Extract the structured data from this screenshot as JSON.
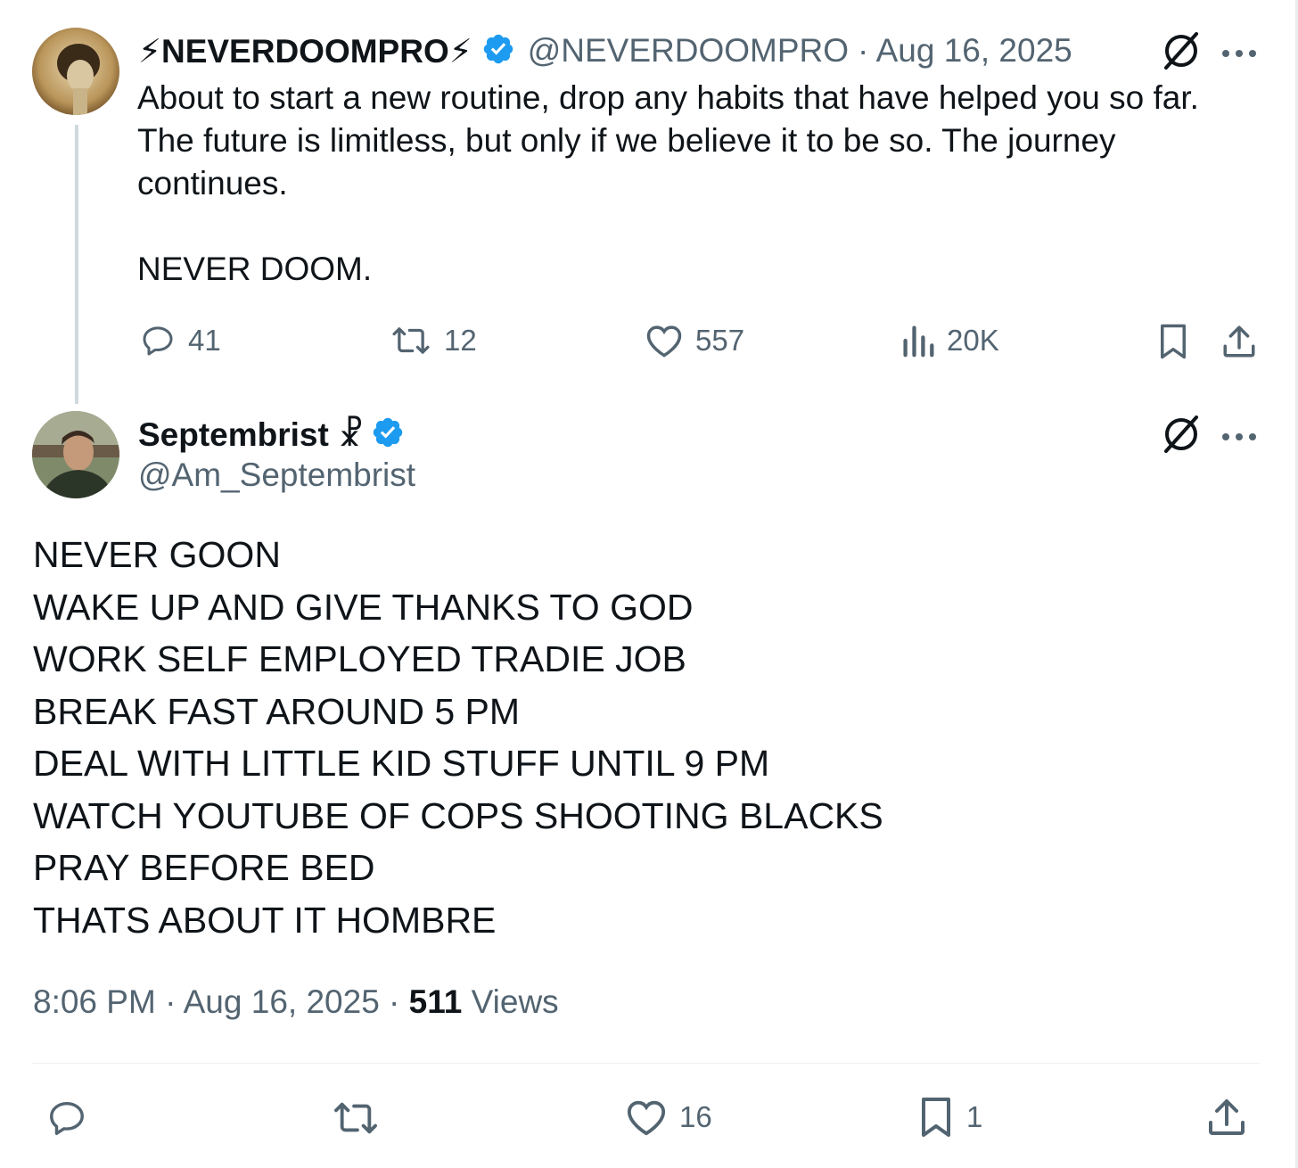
{
  "tweet1": {
    "display_name": "⚡NEVERDOOMPRO⚡",
    "handle": "@NEVERDOOMPRO",
    "date": "· Aug 16, 2025",
    "lines": [
      "About to start a new routine, drop any habits that have helped you so far.",
      "The future is limitless, but only if we believe it to be so. The journey",
      "continues.",
      "",
      "NEVER DOOM."
    ],
    "actions": {
      "replies": "41",
      "reposts": "12",
      "likes": "557",
      "views": "20K"
    }
  },
  "tweet2": {
    "display_name": "Septembrist ☧",
    "handle": "@Am_Septembrist",
    "lines": [
      "NEVER GOON",
      "WAKE UP AND GIVE THANKS TO GOD",
      "WORK SELF EMPLOYED TRADIE JOB",
      "BREAK FAST AROUND 5 PM",
      "DEAL WITH LITTLE KID STUFF UNTIL 9 PM",
      "WATCH YOUTUBE OF COPS SHOOTING BLACKS",
      "PRAY BEFORE BED",
      "THATS ABOUT IT HOMBRE"
    ],
    "time": "8:06 PM · Aug 16, 2025 · ",
    "views_count": "511",
    "views_label": " Views",
    "actions": {
      "likes": "16",
      "bookmarks": "1"
    }
  },
  "colors": {
    "text": "#0f1419",
    "secondary": "#536471",
    "verified": "#1d9bf0",
    "bolt": "#f5a623",
    "thread_line": "#cfd9de"
  }
}
